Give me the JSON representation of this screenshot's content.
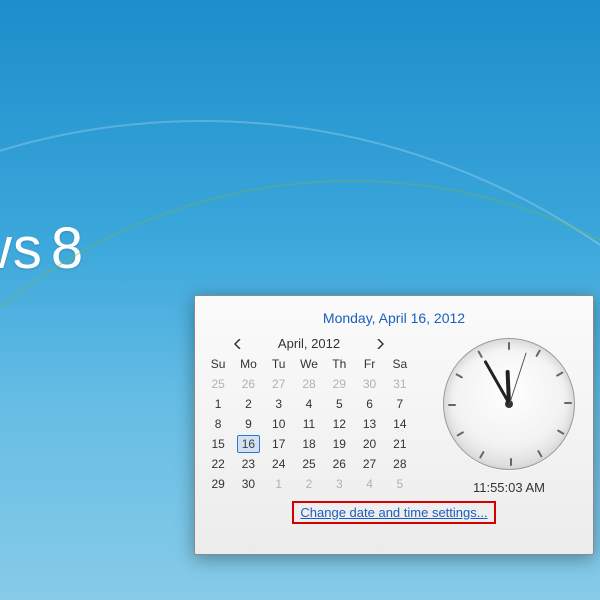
{
  "wallpaper": {
    "text_fragment": "ws",
    "eight": "8"
  },
  "flyout": {
    "date_header": "Monday, April 16, 2012",
    "month_label": "April, 2012",
    "dow": [
      "Su",
      "Mo",
      "Tu",
      "We",
      "Th",
      "Fr",
      "Sa"
    ],
    "weeks": [
      [
        {
          "n": 25,
          "dim": true
        },
        {
          "n": 26,
          "dim": true
        },
        {
          "n": 27,
          "dim": true
        },
        {
          "n": 28,
          "dim": true
        },
        {
          "n": 29,
          "dim": true
        },
        {
          "n": 30,
          "dim": true
        },
        {
          "n": 31,
          "dim": true
        }
      ],
      [
        {
          "n": 1
        },
        {
          "n": 2
        },
        {
          "n": 3
        },
        {
          "n": 4
        },
        {
          "n": 5
        },
        {
          "n": 6
        },
        {
          "n": 7
        }
      ],
      [
        {
          "n": 8
        },
        {
          "n": 9
        },
        {
          "n": 10
        },
        {
          "n": 11
        },
        {
          "n": 12
        },
        {
          "n": 13
        },
        {
          "n": 14
        }
      ],
      [
        {
          "n": 15
        },
        {
          "n": 16,
          "sel": true
        },
        {
          "n": 17
        },
        {
          "n": 18
        },
        {
          "n": 19
        },
        {
          "n": 20
        },
        {
          "n": 21
        }
      ],
      [
        {
          "n": 22
        },
        {
          "n": 23
        },
        {
          "n": 24
        },
        {
          "n": 25
        },
        {
          "n": 26
        },
        {
          "n": 27
        },
        {
          "n": 28
        }
      ],
      [
        {
          "n": 29
        },
        {
          "n": 30
        },
        {
          "n": 1,
          "dim": true
        },
        {
          "n": 2,
          "dim": true
        },
        {
          "n": 3,
          "dim": true
        },
        {
          "n": 4,
          "dim": true
        },
        {
          "n": 5,
          "dim": true
        }
      ]
    ],
    "digital_time": "11:55:03 AM",
    "clock": {
      "hour": 11,
      "minute": 55,
      "second": 3
    },
    "settings_link": "Change date and time settings..."
  }
}
